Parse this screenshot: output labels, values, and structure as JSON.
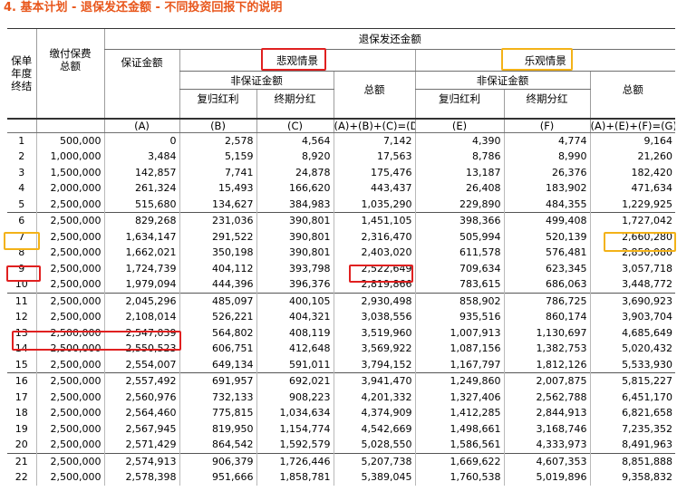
{
  "title": "4. 基本计划 - 退保发还金额 - 不同投资回报下的说明",
  "headers": {
    "policy_year": "保单\n年度\n终结",
    "total_premium": "缴付保费\n总额",
    "surrender_value": "退保发还金额",
    "pessimistic": "悲观情景",
    "optimistic": "乐观情景",
    "guaranteed": "保证金额",
    "non_guaranteed": "非保证金额",
    "reversionary": "复归红利",
    "terminal": "终期分红",
    "total": "总额",
    "col_a": "(A)",
    "col_b": "(B)",
    "col_c": "(C)",
    "col_d": "(A)+(B)+(C)=(D)",
    "col_e": "(E)",
    "col_f": "(F)",
    "col_g": "(A)+(E)+(F)=(G)"
  },
  "highlight_colors": {
    "red": "#e02020",
    "yellow": "#f3b218"
  },
  "rows": [
    {
      "year": "1",
      "premium": "500,000",
      "a": "0",
      "b": "2,578",
      "c": "4,564",
      "d": "7,142",
      "e": "4,390",
      "f": "4,774",
      "g": "9,164"
    },
    {
      "year": "2",
      "premium": "1,000,000",
      "a": "3,484",
      "b": "5,159",
      "c": "8,920",
      "d": "17,563",
      "e": "8,786",
      "f": "8,990",
      "g": "21,260"
    },
    {
      "year": "3",
      "premium": "1,500,000",
      "a": "142,857",
      "b": "7,741",
      "c": "24,878",
      "d": "175,476",
      "e": "13,187",
      "f": "26,376",
      "g": "182,420"
    },
    {
      "year": "4",
      "premium": "2,000,000",
      "a": "261,324",
      "b": "15,493",
      "c": "166,620",
      "d": "443,437",
      "e": "26,408",
      "f": "183,902",
      "g": "471,634"
    },
    {
      "year": "5",
      "premium": "2,500,000",
      "a": "515,680",
      "b": "134,627",
      "c": "384,983",
      "d": "1,035,290",
      "e": "229,890",
      "f": "484,355",
      "g": "1,229,925"
    },
    {
      "year": "6",
      "premium": "2,500,000",
      "a": "829,268",
      "b": "231,036",
      "c": "390,801",
      "d": "1,451,105",
      "e": "398,366",
      "f": "499,408",
      "g": "1,727,042"
    },
    {
      "year": "7",
      "premium": "2,500,000",
      "a": "1,634,147",
      "b": "291,522",
      "c": "390,801",
      "d": "2,316,470",
      "e": "505,994",
      "f": "520,139",
      "g": "2,660,280"
    },
    {
      "year": "8",
      "premium": "2,500,000",
      "a": "1,662,021",
      "b": "350,198",
      "c": "390,801",
      "d": "2,403,020",
      "e": "611,578",
      "f": "576,481",
      "g": "2,850,080"
    },
    {
      "year": "9",
      "premium": "2,500,000",
      "a": "1,724,739",
      "b": "404,112",
      "c": "393,798",
      "d": "2,522,649",
      "e": "709,634",
      "f": "623,345",
      "g": "3,057,718"
    },
    {
      "year": "10",
      "premium": "2,500,000",
      "a": "1,979,094",
      "b": "444,396",
      "c": "396,376",
      "d": "2,819,866",
      "e": "783,615",
      "f": "686,063",
      "g": "3,448,772"
    },
    {
      "year": "11",
      "premium": "2,500,000",
      "a": "2,045,296",
      "b": "485,097",
      "c": "400,105",
      "d": "2,930,498",
      "e": "858,902",
      "f": "786,725",
      "g": "3,690,923"
    },
    {
      "year": "12",
      "premium": "2,500,000",
      "a": "2,108,014",
      "b": "526,221",
      "c": "404,321",
      "d": "3,038,556",
      "e": "935,516",
      "f": "860,174",
      "g": "3,903,704"
    },
    {
      "year": "13",
      "premium": "2,500,000",
      "a": "2,547,039",
      "b": "564,802",
      "c": "408,119",
      "d": "3,519,960",
      "e": "1,007,913",
      "f": "1,130,697",
      "g": "4,685,649"
    },
    {
      "year": "14",
      "premium": "2,500,000",
      "a": "2,550,523",
      "b": "606,751",
      "c": "412,648",
      "d": "3,569,922",
      "e": "1,087,156",
      "f": "1,382,753",
      "g": "5,020,432"
    },
    {
      "year": "15",
      "premium": "2,500,000",
      "a": "2,554,007",
      "b": "649,134",
      "c": "591,011",
      "d": "3,794,152",
      "e": "1,167,797",
      "f": "1,812,126",
      "g": "5,533,930"
    },
    {
      "year": "16",
      "premium": "2,500,000",
      "a": "2,557,492",
      "b": "691,957",
      "c": "692,021",
      "d": "3,941,470",
      "e": "1,249,860",
      "f": "2,007,875",
      "g": "5,815,227"
    },
    {
      "year": "17",
      "premium": "2,500,000",
      "a": "2,560,976",
      "b": "732,133",
      "c": "908,223",
      "d": "4,201,332",
      "e": "1,327,406",
      "f": "2,562,788",
      "g": "6,451,170"
    },
    {
      "year": "18",
      "premium": "2,500,000",
      "a": "2,564,460",
      "b": "775,815",
      "c": "1,034,634",
      "d": "4,374,909",
      "e": "1,412,285",
      "f": "2,844,913",
      "g": "6,821,658"
    },
    {
      "year": "19",
      "premium": "2,500,000",
      "a": "2,567,945",
      "b": "819,950",
      "c": "1,154,774",
      "d": "4,542,669",
      "e": "1,498,661",
      "f": "3,168,746",
      "g": "7,235,352"
    },
    {
      "year": "20",
      "premium": "2,500,000",
      "a": "2,571,429",
      "b": "864,542",
      "c": "1,592,579",
      "d": "5,028,550",
      "e": "1,586,561",
      "f": "4,333,973",
      "g": "8,491,963"
    },
    {
      "year": "21",
      "premium": "2,500,000",
      "a": "2,574,913",
      "b": "906,379",
      "c": "1,726,446",
      "d": "5,207,738",
      "e": "1,669,622",
      "f": "4,607,353",
      "g": "8,851,888"
    },
    {
      "year": "22",
      "premium": "2,500,000",
      "a": "2,578,398",
      "b": "951,666",
      "c": "1,858,781",
      "d": "5,389,045",
      "e": "1,760,538",
      "f": "5,019,896",
      "g": "9,358,832"
    }
  ]
}
